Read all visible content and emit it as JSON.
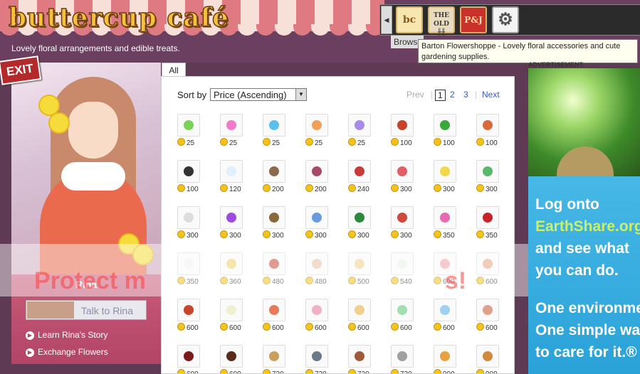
{
  "header": {
    "logo_text": "buttercup café",
    "tagline": "Lovely floral arrangements and edible treats."
  },
  "browse": {
    "label": "Browse",
    "shops": [
      {
        "icon": "bc",
        "name": "shop-icon-buttercup",
        "color": "#f0c25a"
      },
      {
        "icon": "THE OLD",
        "name": "shop-icon-the-old",
        "color": "#4a7a9a"
      },
      {
        "icon": "P&J",
        "name": "shop-icon-pj",
        "color": "#c8322a"
      },
      {
        "icon": "gear",
        "name": "settings-icon",
        "color": "#e8e8e8"
      }
    ],
    "tooltip": "Barton Flowershoppe - Lovely floral accessories and cute gardening supplies."
  },
  "exit_label": "EXIT",
  "advertisement_label": "ADVERTISEMENT",
  "character": {
    "name": "Rina",
    "talk_button": "Talk to Rina",
    "links": [
      "Learn Rina's Story",
      "Exchange Flowers"
    ]
  },
  "shop": {
    "tab": "All",
    "sort_label": "Sort by",
    "sort_value": "Price (Ascending)",
    "pager": {
      "prev": "Prev",
      "pages": [
        "1",
        "2",
        "3"
      ],
      "current": "1",
      "next": "Next"
    },
    "items": [
      {
        "price": "25",
        "color": "#7ad25a"
      },
      {
        "price": "25",
        "color": "#f07acb"
      },
      {
        "price": "25",
        "color": "#5ac0ea"
      },
      {
        "price": "25",
        "color": "#f0a05a"
      },
      {
        "price": "25",
        "color": "#a88ae8"
      },
      {
        "price": "100",
        "color": "#c8422a"
      },
      {
        "price": "100",
        "color": "#3aa83a"
      },
      {
        "price": "100",
        "color": "#d86a3a"
      },
      {
        "price": "100",
        "color": "#333333"
      },
      {
        "price": "120",
        "color": "#dff0ff"
      },
      {
        "price": "200",
        "color": "#8a6a4a"
      },
      {
        "price": "200",
        "color": "#a84a6a"
      },
      {
        "price": "240",
        "color": "#c83a3a"
      },
      {
        "price": "300",
        "color": "#e0606a"
      },
      {
        "price": "300",
        "color": "#f0d84a"
      },
      {
        "price": "300",
        "color": "#5ab86a"
      },
      {
        "price": "300",
        "color": "#dddddd"
      },
      {
        "price": "300",
        "color": "#a04ae0"
      },
      {
        "price": "300",
        "color": "#8a6a3a"
      },
      {
        "price": "300",
        "color": "#6a9ae0"
      },
      {
        "price": "300",
        "color": "#2a8a3a"
      },
      {
        "price": "300",
        "color": "#d04a3a"
      },
      {
        "price": "350",
        "color": "#e86ab0"
      },
      {
        "price": "350",
        "color": "#c8222a"
      },
      {
        "price": "350",
        "color": "#f0f0f0"
      },
      {
        "price": "360",
        "color": "#f0d06a"
      },
      {
        "price": "480",
        "color": "#c84a3a"
      },
      {
        "price": "480",
        "color": "#e8c0a0"
      },
      {
        "price": "500",
        "color": "#f0d08a"
      },
      {
        "price": "540",
        "color": "#e8f0e8"
      },
      {
        "price": "600",
        "color": "#f0a0a0"
      },
      {
        "price": "600",
        "color": "#e8a080"
      },
      {
        "price": "600",
        "color": "#c8442a"
      },
      {
        "price": "600",
        "color": "#f0f0d0"
      },
      {
        "price": "600",
        "color": "#e87a5a"
      },
      {
        "price": "600",
        "color": "#f0b0c8"
      },
      {
        "price": "600",
        "color": "#f0d08a"
      },
      {
        "price": "600",
        "color": "#a0e0b0"
      },
      {
        "price": "600",
        "color": "#a0d0f0"
      },
      {
        "price": "600",
        "color": "#e0a08a"
      },
      {
        "price": "600",
        "color": "#7a1a1a"
      },
      {
        "price": "600",
        "color": "#5a2a1a"
      },
      {
        "price": "720",
        "color": "#c8a05a"
      },
      {
        "price": "720",
        "color": "#6a7a8a"
      },
      {
        "price": "720",
        "color": "#a05a3a"
      },
      {
        "price": "720",
        "color": "#a0a0a0"
      },
      {
        "price": "900",
        "color": "#e8a040"
      },
      {
        "price": "900",
        "color": "#d08a3a"
      }
    ]
  },
  "overlay_text": "Protect m",
  "overlay_text_end": "s!",
  "ad": {
    "lines": [
      "Log onto",
      "EarthShare.org",
      "and see what",
      "you can do.",
      "One environment.",
      "One simple way",
      "to care for it.®"
    ],
    "highlight_color": "#c8f06a"
  }
}
